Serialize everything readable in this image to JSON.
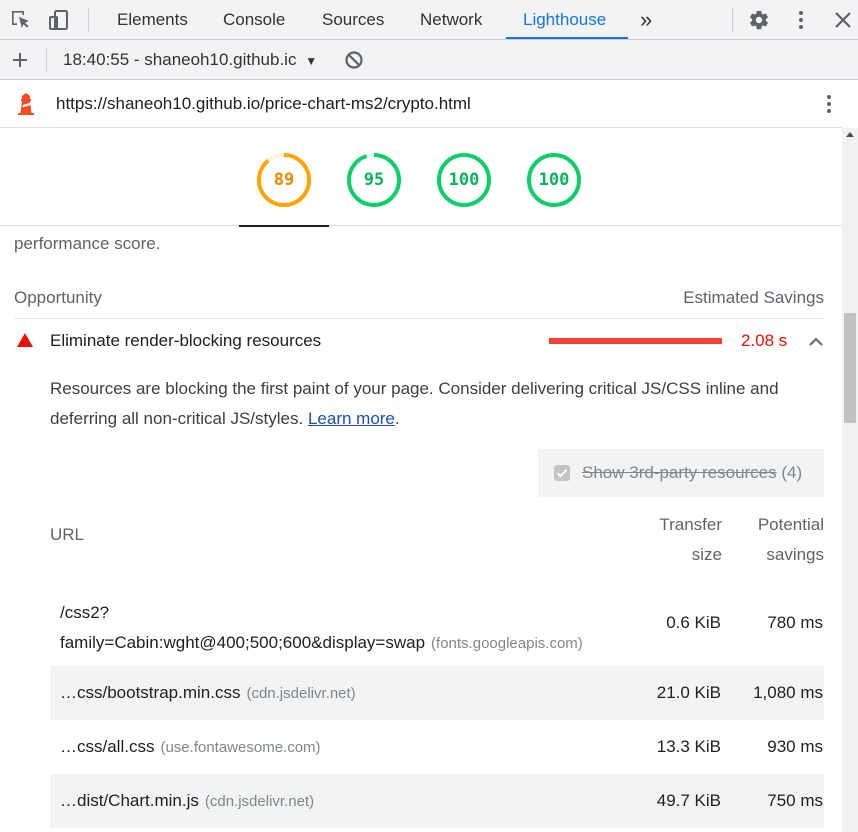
{
  "tabs": {
    "elements": "Elements",
    "console": "Console",
    "sources": "Sources",
    "network": "Network",
    "lighthouse": "Lighthouse",
    "more": "»"
  },
  "report": {
    "selected": "18:40:55 - shaneoh10.github.ic"
  },
  "url": "https://shaneoh10.github.io/price-chart-ms2/crypto.html",
  "scores": [
    {
      "value": "89",
      "fraction": 0.89,
      "color": "#ffa400"
    },
    {
      "value": "95",
      "fraction": 0.95,
      "color": "#0cce6b"
    },
    {
      "value": "100",
      "fraction": 1.0,
      "color": "#0cce6b"
    },
    {
      "value": "100",
      "fraction": 1.0,
      "color": "#0cce6b"
    }
  ],
  "content": {
    "perf_text": "performance score.",
    "opportunity_header": "Opportunity",
    "savings_header": "Estimated Savings",
    "audit": {
      "title": "Eliminate render-blocking resources",
      "value": "2.08 s",
      "description": "Resources are blocking the first paint of your page. Consider delivering critical JS/CSS inline and deferring all non-critical JS/styles.",
      "learn_more": "Learn more",
      "trailing": "."
    },
    "third_party": {
      "label": "Show 3rd-party resources",
      "count": "(4)"
    },
    "table": {
      "col_url": "URL",
      "col_transfer_1": "Transfer",
      "col_transfer_2": "size",
      "col_savings_1": "Potential",
      "col_savings_2": "savings",
      "rows": [
        {
          "url_1": "/css2?",
          "url_2": "family=Cabin:wght@400;500;600&display=swap",
          "host": "(fonts.googleapis.com)",
          "size": "0.6 KiB",
          "savings": "780 ms"
        },
        {
          "url": "…css/bootstrap.min.css",
          "host": "(cdn.jsdelivr.net)",
          "size": "21.0 KiB",
          "savings": "1,080 ms"
        },
        {
          "url": "…css/all.css",
          "host": "(use.fontawesome.com)",
          "size": "13.3 KiB",
          "savings": "930 ms"
        },
        {
          "url": "…dist/Chart.min.js",
          "host": "(cdn.jsdelivr.net)",
          "size": "49.7 KiB",
          "savings": "750 ms"
        }
      ]
    }
  },
  "colors": {
    "accent": "#1a73e8",
    "fail": "#eb0f00",
    "average": "#ffa400",
    "pass": "#0cce6b"
  },
  "icons": [
    "inspect-element-icon",
    "device-toolbar-icon",
    "settings-gear-icon",
    "more-vert-icon",
    "close-icon",
    "plus-icon",
    "clear-icon",
    "lighthouse-logo-icon",
    "chevron-up-icon",
    "checkbox-icon"
  ]
}
